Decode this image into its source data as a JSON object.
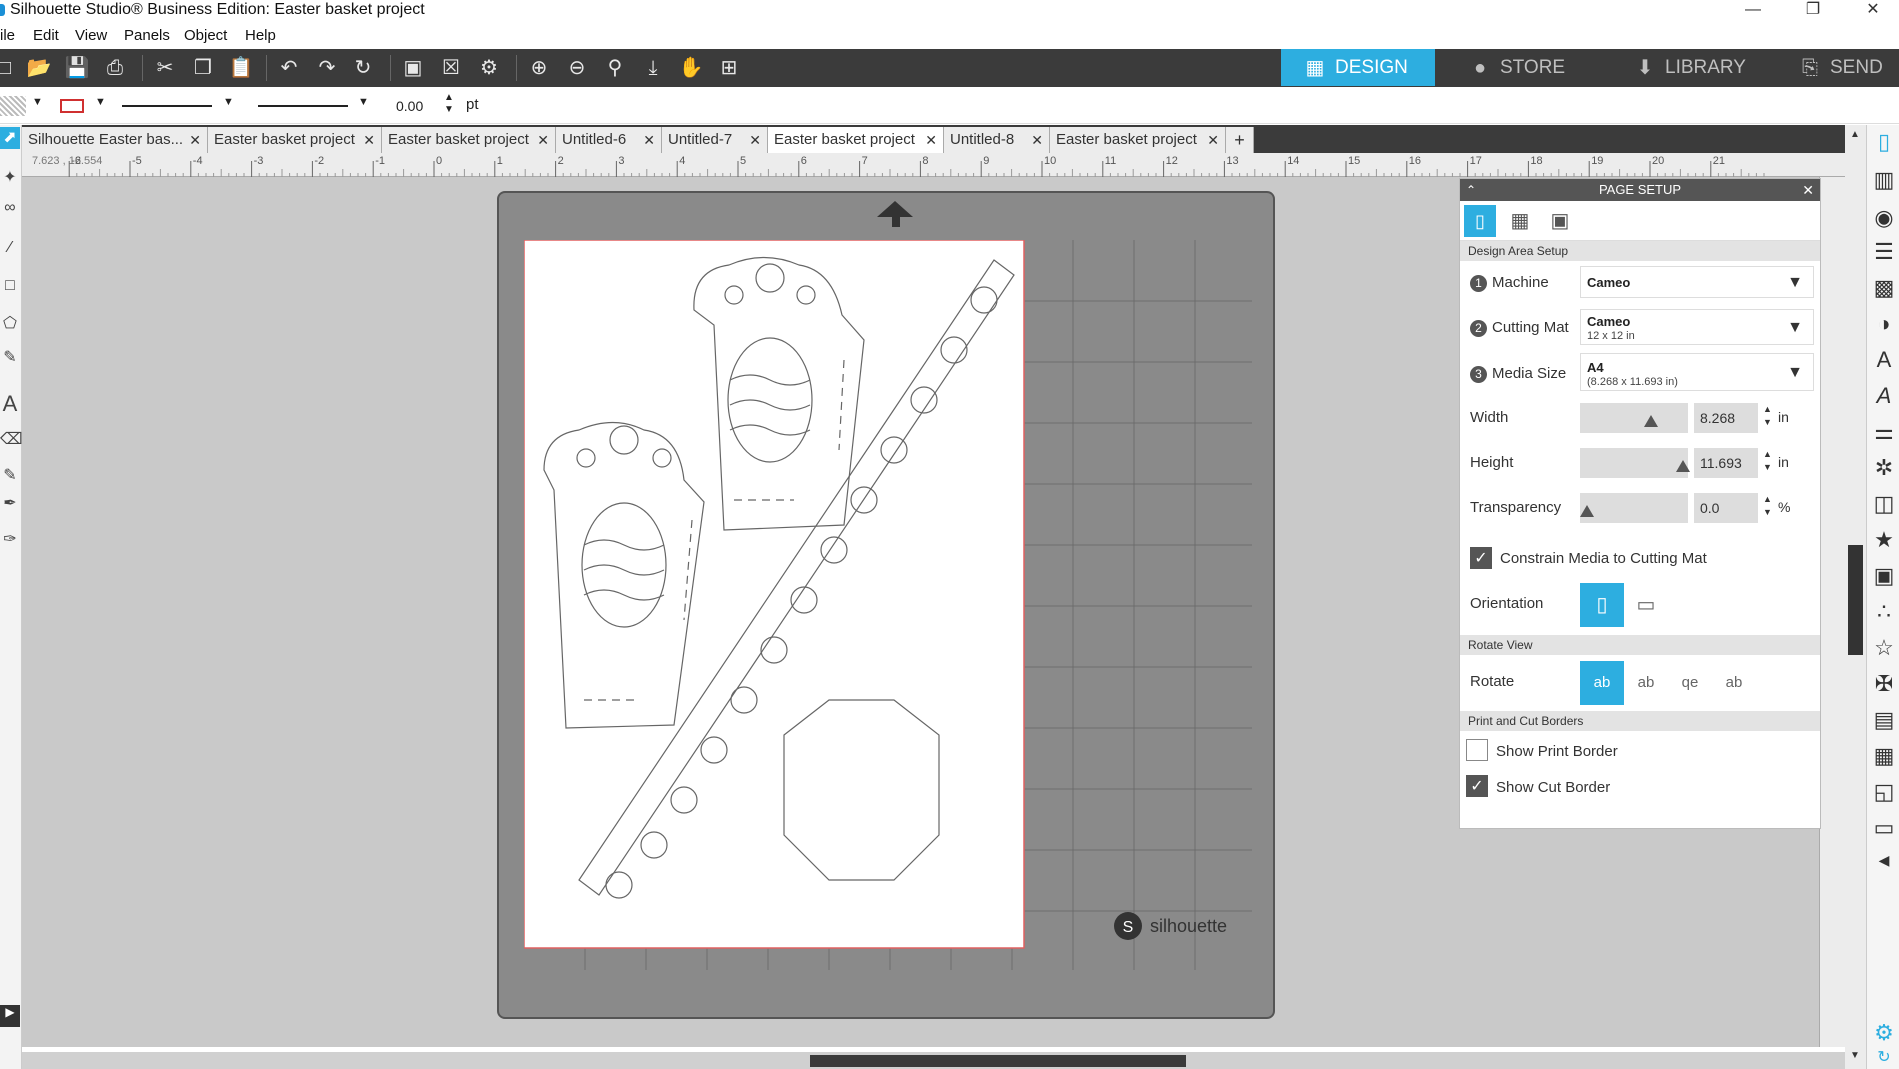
{
  "window": {
    "title": "Silhouette Studio® Business Edition: Easter basket project",
    "minimize": "—",
    "restore": "❐",
    "close": "✕"
  },
  "menu": [
    "ile",
    "Edit",
    "View",
    "Panels",
    "Object",
    "Help"
  ],
  "nav_tabs": [
    {
      "label": "DESIGN",
      "icon": "grid-icon",
      "active": true
    },
    {
      "label": "STORE",
      "icon": "store-logo-icon",
      "active": false
    },
    {
      "label": "LIBRARY",
      "icon": "library-icon",
      "active": false
    },
    {
      "label": "SEND",
      "icon": "send-icon",
      "active": false
    }
  ],
  "propbar": {
    "line_width": "0.00",
    "unit": "pt"
  },
  "doc_tabs": [
    {
      "label": "Silhouette Easter bas...",
      "active": false
    },
    {
      "label": "Easter basket project",
      "active": false
    },
    {
      "label": "Easter basket project",
      "active": false
    },
    {
      "label": "Untitled-6",
      "active": false
    },
    {
      "label": "Untitled-7",
      "active": false
    },
    {
      "label": "Easter basket project",
      "active": true
    },
    {
      "label": "Untitled-8",
      "active": false
    },
    {
      "label": "Easter basket project",
      "active": false
    }
  ],
  "doc_tab_add": "+",
  "ruler": {
    "coords": "7.623 , 12.554",
    "ticks": [
      "-6",
      "-5",
      "-4",
      "-3",
      "-2",
      "-1",
      "0",
      "1",
      "2",
      "3",
      "4",
      "5",
      "6",
      "7",
      "8",
      "9",
      "10",
      "11",
      "12",
      "13",
      "14",
      "15",
      "16",
      "17",
      "18",
      "19",
      "20",
      "21"
    ]
  },
  "mat": {
    "brand": "silhouette"
  },
  "page_setup": {
    "title": "PAGE SETUP",
    "section_design_area": "Design Area Setup",
    "machine_label": "Machine",
    "machine_value": "Cameo",
    "cutting_mat_label": "Cutting Mat",
    "cutting_mat_value": "Cameo",
    "cutting_mat_sub": "12 x 12 in",
    "media_size_label": "Media Size",
    "media_size_value": "A4",
    "media_size_sub": "(8.268 x 11.693 in)",
    "width_label": "Width",
    "width_value": "8.268",
    "height_label": "Height",
    "height_value": "11.693",
    "transparency_label": "Transparency",
    "transparency_value": "0.0",
    "unit_in": "in",
    "unit_pct": "%",
    "constrain_label": "Constrain Media to Cutting Mat",
    "constrain_checked": true,
    "orientation_label": "Orientation",
    "section_rotate_view": "Rotate View",
    "rotate_label": "Rotate",
    "section_borders": "Print and Cut Borders",
    "show_print_border_label": "Show Print Border",
    "show_print_border_checked": false,
    "show_cut_border_label": "Show Cut Border",
    "show_cut_border_checked": true
  },
  "colors": {
    "accent": "#2daee0",
    "toolbar": "#3b3b3b",
    "mat": "#8a8a8a",
    "canvas": "#c9c9c9",
    "cut_border": "#e06060"
  }
}
